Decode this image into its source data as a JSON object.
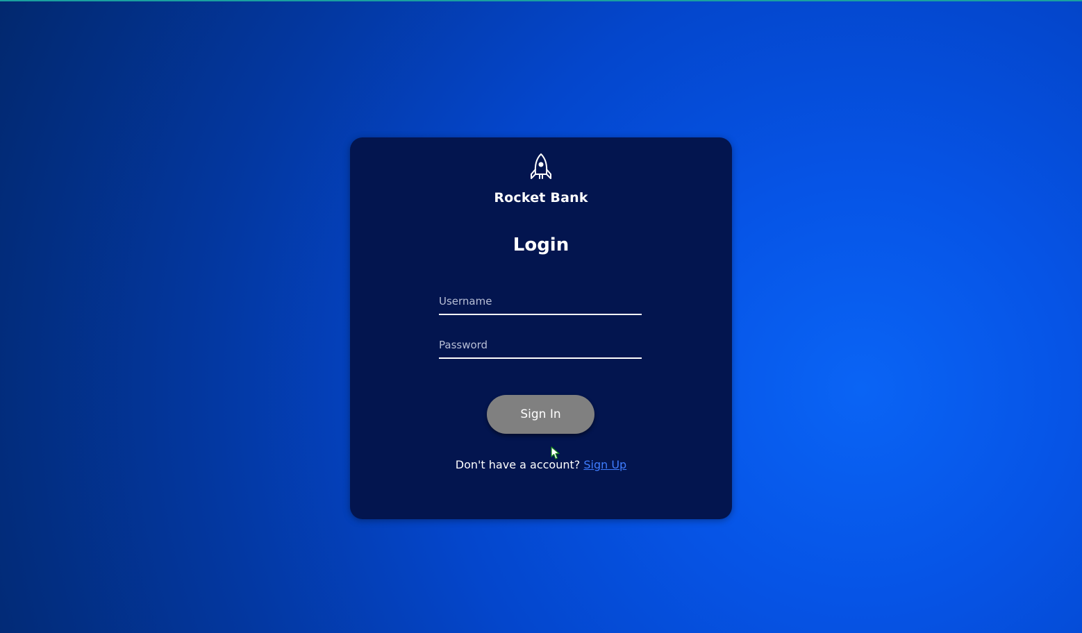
{
  "app": {
    "brand_name": "Rocket Bank",
    "logo_icon": "rocket-icon"
  },
  "login": {
    "title": "Login",
    "username_placeholder": "Username",
    "username_value": "",
    "password_placeholder": "Password",
    "password_value": "",
    "sign_in_label": "Sign In",
    "signup_prompt": "Don't have a account?",
    "signup_link": "Sign Up"
  },
  "colors": {
    "card_background": "#03154f",
    "button_background": "#808080",
    "link": "#3f7dff",
    "accent_top_line": "#1aa0a0"
  }
}
